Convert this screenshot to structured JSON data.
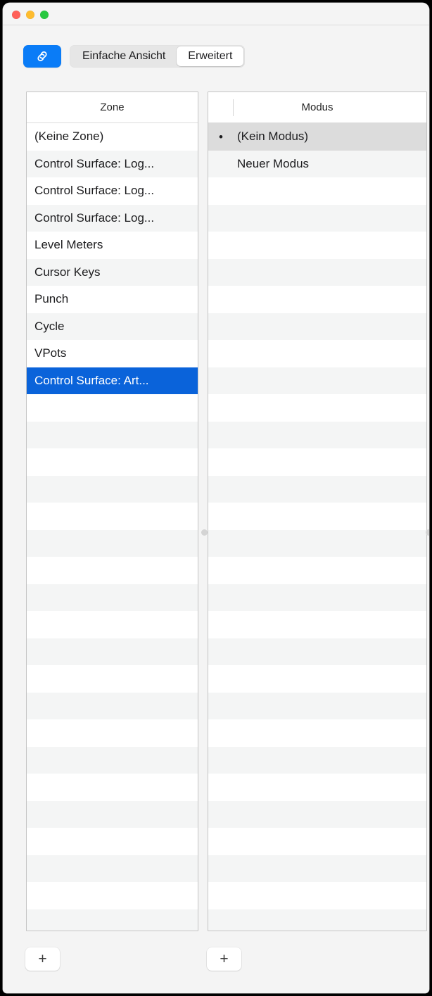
{
  "window": {
    "traffic_lights": [
      {
        "name": "close",
        "color": "#ff5f57"
      },
      {
        "name": "minimize",
        "color": "#febc2e"
      },
      {
        "name": "zoom",
        "color": "#28c840"
      }
    ]
  },
  "toolbar": {
    "link_button": {
      "icon": "link-chain-icon",
      "active": true,
      "color": "#0a7cf7"
    },
    "segmented_control": {
      "options": [
        {
          "label": "Einfache Ansicht",
          "selected": false
        },
        {
          "label": "Erweitert",
          "selected": true
        }
      ]
    }
  },
  "zone_table": {
    "header": "Zone",
    "add_button_label": "+",
    "rows": [
      {
        "label": "(Keine Zone)",
        "selected": false
      },
      {
        "label": "Control Surface: Log...",
        "selected": false
      },
      {
        "label": "Control Surface: Log...",
        "selected": false
      },
      {
        "label": "Control Surface: Log...",
        "selected": false
      },
      {
        "label": "Level Meters",
        "selected": false
      },
      {
        "label": "Cursor Keys",
        "selected": false
      },
      {
        "label": "Punch",
        "selected": false
      },
      {
        "label": "Cycle",
        "selected": false
      },
      {
        "label": "VPots",
        "selected": false
      },
      {
        "label": "Control Surface: Art...",
        "selected": true
      }
    ],
    "empty_row_count": 21,
    "selection_color": "#0a63da"
  },
  "modus_table": {
    "header": "Modus",
    "add_button_label": "+",
    "rows": [
      {
        "marker": "•",
        "label": "(Kein Modus)",
        "selected": true
      },
      {
        "marker": "",
        "label": "Neuer Modus",
        "selected": false
      }
    ],
    "empty_row_count": 29,
    "selection_color": "#dcdcdc"
  }
}
